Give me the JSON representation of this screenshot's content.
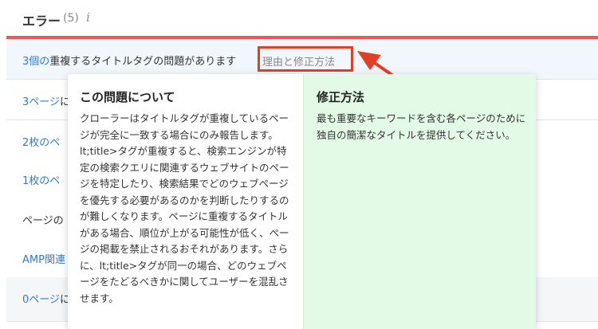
{
  "header": {
    "title": "エラー",
    "count": "(5)",
    "info_glyph": "i",
    "info_icon": "info-icon"
  },
  "issue_row": {
    "count_link": "3個の",
    "text": "重複するタイトルタグの問題があります",
    "reason_link": "理由と修正方法"
  },
  "rows": [
    {
      "link": "3ページ",
      "text": "に"
    },
    {
      "link": "2枚のペ",
      "text": ""
    },
    {
      "link": "1枚のペ",
      "text": ""
    },
    {
      "link": "",
      "text": "ページの"
    },
    {
      "link": "AMP関連",
      "text": ""
    },
    {
      "link": "0ページ",
      "text": "に"
    }
  ],
  "popover": {
    "about_title": "この問題について",
    "about_body": "クローラーはタイトルタグが重複しているページが完全に一致する場合にのみ報告します。lt;title>タグが重複すると、検索エンジンが特定の検索クエリに関連するウェブサイトのページを特定したり、検索結果でどのウェブページを優先する必要があるのかを判断したりするのが難しくなります。ページに重複するタイトルがある場合、順位が上がる可能性が低く、ページの掲載を禁止されるおそれがあります。さらに、lt;title>タグが同一の場合、どのウェブページをたどるべきかに関してユーザーを混乱させます。",
    "fix_title": "修正方法",
    "fix_body": "最も重要なキーワードを含む各ページのために独自の簡潔なタイトルを提供してください。"
  },
  "colors": {
    "accent_red": "#ef5753",
    "link_blue": "#2f7bcc",
    "annotation_red": "#e43e24",
    "fix_panel_green": "#e3fbe6"
  }
}
